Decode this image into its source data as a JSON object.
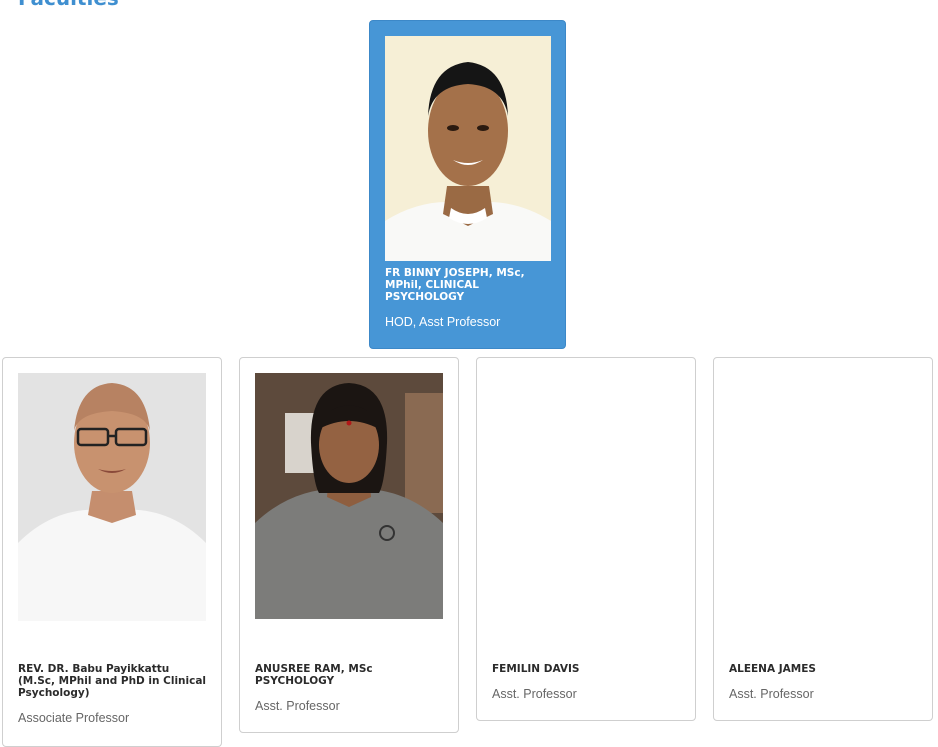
{
  "section": {
    "title": "Faculties"
  },
  "hod": {
    "name": "FR BINNY JOSEPH, MSc, MPhil, CLINICAL PSYCHOLOGY",
    "role": "HOD, Asst Professor"
  },
  "faculty": [
    {
      "name": "REV. DR. Babu Payikkattu (M.Sc, MPhil and PhD in Clinical Psychology)",
      "role": "Associate Professor"
    },
    {
      "name": "ANUSREE RAM, MSc PSYCHOLOGY",
      "role": "Asst. Professor"
    },
    {
      "name": "FEMILIN DAVIS",
      "role": "Asst. Professor"
    },
    {
      "name": "ALEENA JAMES",
      "role": "Asst. Professor"
    }
  ]
}
